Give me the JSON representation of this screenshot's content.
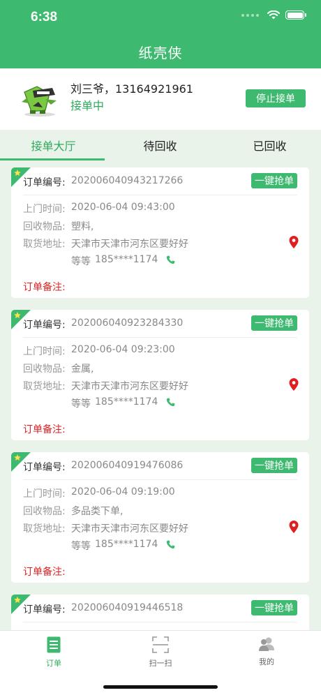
{
  "status_bar": {
    "time": "6:38"
  },
  "header": {
    "title": "纸壳侠"
  },
  "profile": {
    "name_phone": "刘三爷，13164921961",
    "status": "接单中",
    "stop_button": "停止接单"
  },
  "tabs": [
    {
      "label": "接单大厅",
      "active": true
    },
    {
      "label": "待回收",
      "active": false
    },
    {
      "label": "已回收",
      "active": false
    }
  ],
  "labels": {
    "order_no": "订单编号:",
    "visit_time": "上门时间:",
    "items": "回收物品:",
    "address": "取货地址:",
    "remark": "订单备注:",
    "grab": "一键抢单"
  },
  "orders": [
    {
      "order_no": "202006040943217266",
      "visit_time": "2020-06-04 09:43:00",
      "items": "塑料,",
      "address_line1": "天津市天津市河东区要好好",
      "address_line2": "等等",
      "phone": "185****1174"
    },
    {
      "order_no": "202006040923284330",
      "visit_time": "2020-06-04 09:23:00",
      "items": "金属,",
      "address_line1": "天津市天津市河东区要好好",
      "address_line2": "等等",
      "phone": "185****1174"
    },
    {
      "order_no": "202006040919476086",
      "visit_time": "2020-06-04 09:19:00",
      "items": "多品类下单,",
      "address_line1": "天津市天津市河东区要好好",
      "address_line2": "等等",
      "phone": "185****1174"
    },
    {
      "order_no": "202006040919446518"
    }
  ],
  "tabbar": [
    {
      "label": "订单",
      "icon": "order-list-icon",
      "active": true
    },
    {
      "label": "扫一扫",
      "icon": "scan-icon",
      "active": false
    },
    {
      "label": "我的",
      "icon": "user-icon",
      "active": false
    }
  ],
  "colors": {
    "primary": "#3dba6f",
    "remark": "#e02020",
    "pin": "#e02020"
  }
}
